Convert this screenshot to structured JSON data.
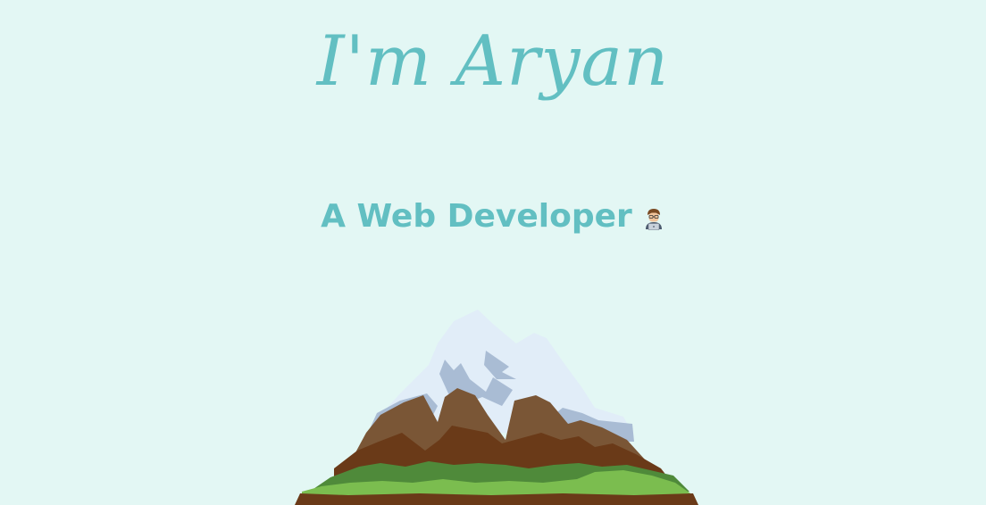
{
  "hero": {
    "title": "I'm Aryan",
    "subtitle": "A Web Developer",
    "subtitle_icon": "technologist-icon",
    "illustration": "mountain-illustration"
  },
  "colors": {
    "background": "#e3f7f4",
    "accent": "#62bfc2"
  }
}
